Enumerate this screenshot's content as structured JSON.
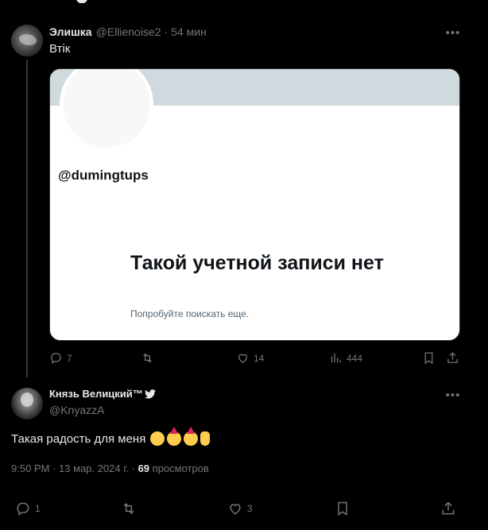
{
  "tweet1": {
    "name": "Элишка",
    "handle": "@Ellienoise2",
    "separator": "·",
    "time": "54 мин",
    "text": "Втік",
    "card": {
      "handle": "@dumingtups",
      "title": "Такой учетной записи нет",
      "subtitle": "Попробуйте поискать еще."
    },
    "actions": {
      "replies": "7",
      "likes": "14",
      "views": "444"
    }
  },
  "tweet2": {
    "name": "Князь Велицкий™",
    "handle": "@KnyazzA",
    "text": "Такая радость для меня",
    "time": "9:50 PM",
    "date": "13 мар. 2024 г.",
    "views_count": "69",
    "views_label": "просмотров",
    "actions": {
      "replies": "1",
      "likes": "3"
    }
  },
  "colors": {
    "background": "#000000",
    "text": "#e7e9ea",
    "muted": "#71767b",
    "card_bg": "#ffffff",
    "banner": "#cfd9de"
  },
  "icons": [
    "more-icon",
    "reply-icon",
    "retweet-icon",
    "like-icon",
    "views-icon",
    "bookmark-icon",
    "share-icon",
    "bird-icon"
  ]
}
